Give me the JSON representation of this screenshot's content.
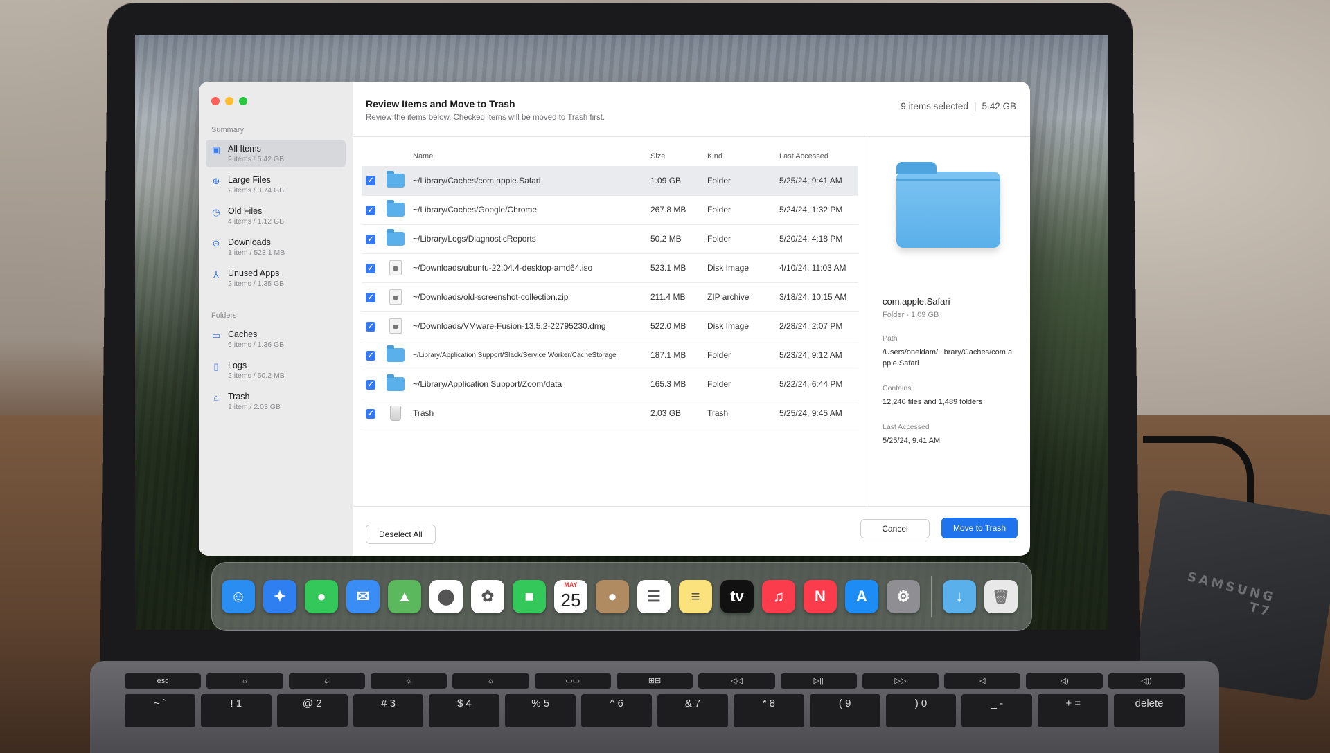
{
  "app": {
    "title": "Review Items and Move to Trash",
    "subtitle": "Review the items below.  Checked items will be moved to Trash first.",
    "selection_count": "9 items selected",
    "selection_size": "5.42 GB"
  },
  "sidebar": {
    "summary_heading": "Summary",
    "summary_items": [
      {
        "label": "All Items",
        "sub": "9 items / 5.42 GB",
        "icon": "all-items-icon",
        "active": true
      },
      {
        "label": "Large Files",
        "sub": "2 items / 3.74 GB",
        "icon": "large-files-icon"
      },
      {
        "label": "Old Files",
        "sub": "4 items / 1.12 GB",
        "icon": "old-files-icon"
      },
      {
        "label": "Downloads",
        "sub": "1 item / 523.1 MB",
        "icon": "downloads-icon"
      },
      {
        "label": "Unused Apps",
        "sub": "2 items / 1.35 GB",
        "icon": "apps-icon"
      }
    ],
    "folders_heading": "Folders",
    "folder_items": [
      {
        "label": "Caches",
        "sub": "6 items / 1.36 GB",
        "icon": "folder-icon"
      },
      {
        "label": "Logs",
        "sub": "2 items / 50.2 MB",
        "icon": "document-icon"
      },
      {
        "label": "Trash",
        "sub": "1 item / 2.03 GB",
        "icon": "trash-icon"
      }
    ]
  },
  "table": {
    "columns": {
      "name": "Name",
      "size": "Size",
      "kind": "Kind",
      "accessed": "Last Accessed"
    },
    "rows": [
      {
        "checked": true,
        "icon": "folder",
        "name": "~/Library/Caches/com.apple.Safari",
        "size": "1.09 GB",
        "kind": "Folder",
        "accessed": "5/25/24, 9:41 AM",
        "selected": true
      },
      {
        "checked": true,
        "icon": "folder",
        "name": "~/Library/Caches/Google/Chrome",
        "size": "267.8 MB",
        "kind": "Folder",
        "accessed": "5/24/24, 1:32 PM"
      },
      {
        "checked": true,
        "icon": "folder",
        "name": "~/Library/Logs/DiagnosticReports",
        "size": "50.2 MB",
        "kind": "Folder",
        "accessed": "5/20/24, 4:18 PM"
      },
      {
        "checked": true,
        "icon": "file",
        "name": "~/Downloads/ubuntu-22.04.4-desktop-amd64.iso",
        "size": "523.1 MB",
        "kind": "Disk Image",
        "accessed": "4/10/24, 11:03 AM"
      },
      {
        "checked": true,
        "icon": "file",
        "name": "~/Downloads/old-screenshot-collection.zip",
        "size": "211.4 MB",
        "kind": "ZIP archive",
        "accessed": "3/18/24, 10:15 AM"
      },
      {
        "checked": true,
        "icon": "file",
        "name": "~/Downloads/VMware-Fusion-13.5.2-22795230.dmg",
        "size": "522.0 MB",
        "kind": "Disk Image",
        "accessed": "2/28/24, 2:07 PM"
      },
      {
        "checked": true,
        "icon": "folder",
        "name": "~/Library/Application Support/Slack/Service Worker/CacheStorage",
        "size": "187.1 MB",
        "kind": "Folder",
        "accessed": "5/23/24, 9:12 AM"
      },
      {
        "checked": true,
        "icon": "folder",
        "name": "~/Library/Application Support/Zoom/data",
        "size": "165.3 MB",
        "kind": "Folder",
        "accessed": "5/22/24, 6:44 PM"
      },
      {
        "checked": true,
        "icon": "trash",
        "name": "Trash",
        "size": "2.03 GB",
        "kind": "Trash",
        "accessed": "5/25/24, 9:45 AM"
      }
    ]
  },
  "detail": {
    "name": "com.apple.Safari",
    "kind": "Folder - 1.09 GB",
    "path_label": "Path",
    "path_value": "/Users/oneidam/Library/Caches/com.apple.Safari",
    "contains_label": "Contains",
    "contains_value": "12,246 files and 1,489 folders",
    "accessed_label": "Last Accessed",
    "accessed_value": "5/25/24, 9:41 AM"
  },
  "footer": {
    "deselect_label": "Deselect All",
    "cancel_label": "Cancel",
    "move_label": "Move to Trash"
  },
  "dock": {
    "apps": [
      {
        "name": "finder-icon",
        "color": "#2a8df2",
        "glyph": "☺"
      },
      {
        "name": "safari-icon",
        "color": "#2f7ff0",
        "glyph": "✦"
      },
      {
        "name": "messages-icon",
        "color": "#34c759",
        "glyph": "●"
      },
      {
        "name": "mail-icon",
        "color": "#3a8df5",
        "glyph": "✉"
      },
      {
        "name": "maps-icon",
        "color": "#5cb85c",
        "glyph": "▲"
      },
      {
        "name": "google-maps-icon",
        "color": "#ffffff",
        "glyph": "⬤"
      },
      {
        "name": "photos-icon",
        "color": "#ffffff",
        "glyph": "✿"
      },
      {
        "name": "facetime-icon",
        "color": "#34c759",
        "glyph": "■"
      },
      {
        "name": "calendar-icon",
        "color": "#ffffff",
        "month": "MAY",
        "day": "25"
      },
      {
        "name": "contacts-icon",
        "color": "#b08a60",
        "glyph": "●"
      },
      {
        "name": "reminders-icon",
        "color": "#ffffff",
        "glyph": "☰"
      },
      {
        "name": "notes-icon",
        "color": "#fbe27c",
        "glyph": "≡"
      },
      {
        "name": "apple-tv-icon",
        "color": "#111111",
        "glyph": "tv"
      },
      {
        "name": "music-icon",
        "color": "#fa3c4c",
        "glyph": "♫"
      },
      {
        "name": "news-icon",
        "color": "#fa3c4c",
        "glyph": "N"
      },
      {
        "name": "app-store-icon",
        "color": "#1e8cf5",
        "glyph": "A"
      },
      {
        "name": "system-settings-icon",
        "color": "#8e8e93",
        "glyph": "⚙"
      }
    ],
    "right_items": [
      {
        "name": "downloads-folder-icon",
        "color": "#5ab0ea",
        "glyph": "↓"
      },
      {
        "name": "trash-can-icon",
        "color": "#e8e8e8",
        "glyph": "🗑"
      }
    ]
  },
  "hardware": {
    "ssd_brand": "SAMSUNG",
    "ssd_model": "T7",
    "keys_row1": [
      "esc",
      "☼",
      "☼",
      "☼",
      "☼",
      "▭▭",
      "⊞⊟",
      "◁◁",
      "▷||",
      "▷▷",
      "◁",
      "◁)",
      "◁))"
    ],
    "keys_row2": [
      "~ `",
      "! 1",
      "@ 2",
      "# 3",
      "$ 4",
      "% 5",
      "^ 6",
      "& 7",
      "* 8",
      "( 9",
      ") 0",
      "_ -",
      "+ =",
      "delete"
    ]
  }
}
